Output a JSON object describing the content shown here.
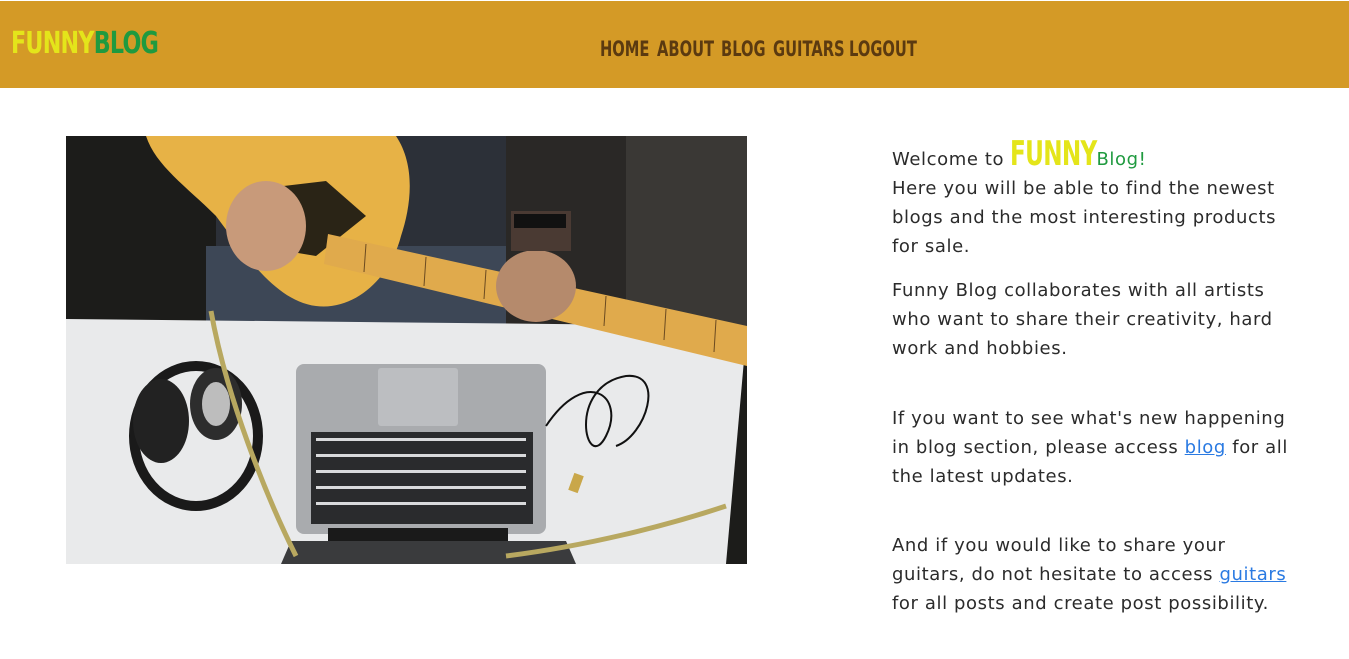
{
  "header": {
    "logo_funny": "FUNNY",
    "logo_blog": "BLOG",
    "nav": [
      "HOME",
      "ABOUT",
      "BLOG",
      "GUITARS",
      "LOGOUT"
    ]
  },
  "hero": {
    "image_label": "guitar-laptop-headphones-photo"
  },
  "content": {
    "welcome_prefix": "Welcome to ",
    "welcome_funny": "FUNNY",
    "welcome_blog": "Blog!",
    "p1": "Here you will be able to find the newest blogs and the most interesting products for sale.",
    "p2": "Funny Blog collaborates with all artists who want to share their creativity, hard work and hobbies.",
    "p3_before": "If you want to see what's new happening in blog section, please access ",
    "p3_link": "blog",
    "p3_after": " for all the latest updates.",
    "p4_before": "And if you would like to share your guitars, do not hesitate to access ",
    "p4_link": "guitars",
    "p4_after": " for all posts and create post possibility."
  },
  "colors": {
    "header_bg": "#d49a26",
    "logo_yellow": "#e4e51a",
    "logo_green": "#1f9a3f",
    "nav_text": "#5b3a10",
    "link": "#2a7ae2"
  }
}
